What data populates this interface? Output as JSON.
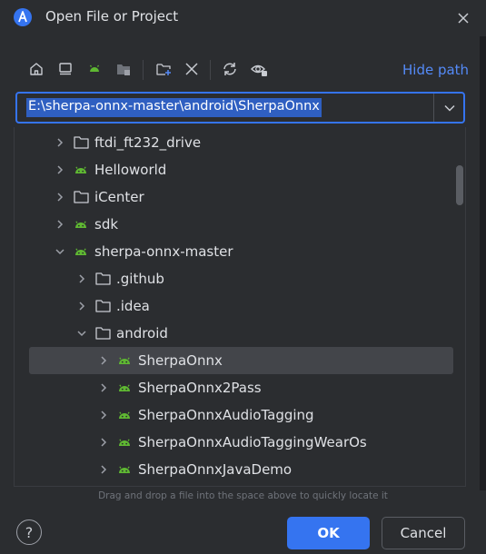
{
  "dialog": {
    "title": "Open File or Project"
  },
  "toolbar": {
    "hide_path_label": "Hide path"
  },
  "path": {
    "value": "E:\\sherpa-onnx-master\\android\\SherpaOnnx"
  },
  "tree": {
    "items": [
      {
        "label": "ftdi_ft232_drive",
        "icon": "folder-icon",
        "depth": 1,
        "expanded": false
      },
      {
        "label": "Helloworld",
        "icon": "android-icon",
        "depth": 1,
        "expanded": false
      },
      {
        "label": "iCenter",
        "icon": "folder-icon",
        "depth": 1,
        "expanded": false
      },
      {
        "label": "sdk",
        "icon": "android-icon",
        "depth": 1,
        "expanded": false
      },
      {
        "label": "sherpa-onnx-master",
        "icon": "android-icon",
        "depth": 1,
        "expanded": true
      },
      {
        "label": ".github",
        "icon": "folder-icon",
        "depth": 2,
        "expanded": false
      },
      {
        "label": ".idea",
        "icon": "folder-icon",
        "depth": 2,
        "expanded": false
      },
      {
        "label": "android",
        "icon": "folder-icon",
        "depth": 2,
        "expanded": true
      },
      {
        "label": "SherpaOnnx",
        "icon": "android-icon",
        "depth": 3,
        "expanded": false,
        "selected": true
      },
      {
        "label": "SherpaOnnx2Pass",
        "icon": "android-icon",
        "depth": 3,
        "expanded": false
      },
      {
        "label": "SherpaOnnxAudioTagging",
        "icon": "android-icon",
        "depth": 3,
        "expanded": false
      },
      {
        "label": "SherpaOnnxAudioTaggingWearOs",
        "icon": "android-icon",
        "depth": 3,
        "expanded": false
      },
      {
        "label": "SherpaOnnxJavaDemo",
        "icon": "android-icon",
        "depth": 3,
        "expanded": false
      }
    ]
  },
  "footer": {
    "hint": "Drag and drop a file into the space above to quickly locate it",
    "help_label": "?",
    "ok_label": "OK",
    "cancel_label": "Cancel"
  },
  "colors": {
    "accent": "#3574f0",
    "android_green": "#5fb832",
    "link": "#548af7"
  }
}
